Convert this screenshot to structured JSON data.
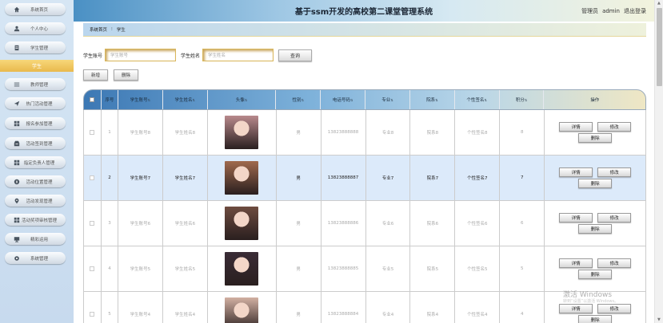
{
  "app": {
    "title": "基于ssm开发的高校第二课堂管理系统",
    "user_role": "管理员",
    "user_name": "admin",
    "logout": "退出登录"
  },
  "sidebar": {
    "items": [
      {
        "label": "系统首页",
        "icon": "home-icon"
      },
      {
        "label": "个人中心",
        "icon": "user-icon"
      },
      {
        "label": "学生管理",
        "icon": "document-icon"
      },
      {
        "label": "学生",
        "icon": "",
        "active": true
      },
      {
        "label": "教师管理",
        "icon": "list-icon"
      },
      {
        "label": "热门活动管理",
        "icon": "send-icon"
      },
      {
        "label": "报名参加管理",
        "icon": "grid-icon"
      },
      {
        "label": "活动签到管理",
        "icon": "inbox-icon"
      },
      {
        "label": "指定负责人管理",
        "icon": "grid-icon"
      },
      {
        "label": "活动位置管理",
        "icon": "compass-icon"
      },
      {
        "label": "活动发现管理",
        "icon": "pin-icon"
      },
      {
        "label": "活动奖项审核管理",
        "icon": "grid-icon"
      },
      {
        "label": "精彩运用",
        "icon": "monitor-icon"
      },
      {
        "label": "系统管理",
        "icon": "settings-icon"
      }
    ]
  },
  "breadcrumb": {
    "home": "系统首页",
    "sep": "⁝",
    "current": "学生"
  },
  "search": {
    "account_label": "学生账号",
    "account_placeholder": "学生账号",
    "name_label": "学生姓名",
    "name_placeholder": "学生姓名",
    "query_button": "查询"
  },
  "toolbar": {
    "add": "新增",
    "delete": "删除"
  },
  "table": {
    "headers": [
      "",
      "序号",
      "学生账号",
      "学生姓名",
      "头像",
      "性别",
      "电话号码",
      "专业",
      "院系",
      "个性签名",
      "积分",
      "操作"
    ],
    "actions": {
      "detail": "详情",
      "edit": "修改",
      "delete": "删除"
    },
    "rows": [
      {
        "idx": "1",
        "account": "学生账号8",
        "name": "学生姓名8",
        "gender": "男",
        "phone": "13823888888",
        "major": "专业8",
        "dept": "院系8",
        "sign": "个性签名8",
        "score": "8",
        "av": "#b8898c"
      },
      {
        "idx": "2",
        "account": "学生账号7",
        "name": "学生姓名7",
        "gender": "男",
        "phone": "13823888887",
        "major": "专业7",
        "dept": "院系7",
        "sign": "个性签名7",
        "score": "7",
        "av": "#a06a4e"
      },
      {
        "idx": "3",
        "account": "学生账号6",
        "name": "学生姓名6",
        "gender": "男",
        "phone": "13823888886",
        "major": "专业6",
        "dept": "院系6",
        "sign": "个性签名6",
        "score": "6",
        "av": "#6e4c40"
      },
      {
        "idx": "4",
        "account": "学生账号5",
        "name": "学生姓名5",
        "gender": "男",
        "phone": "13823888885",
        "major": "专业5",
        "dept": "院系5",
        "sign": "个性签名5",
        "score": "5",
        "av": "#3a2c36"
      },
      {
        "idx": "5",
        "account": "学生账号4",
        "name": "学生姓名4",
        "gender": "男",
        "phone": "13823888884",
        "major": "专业4",
        "dept": "院系4",
        "sign": "个性签名4",
        "score": "4",
        "av": "#d2b0a2"
      }
    ]
  },
  "watermark": {
    "line1": "激活 Windows",
    "line2": "转到“设置”以激活 Windows。"
  }
}
